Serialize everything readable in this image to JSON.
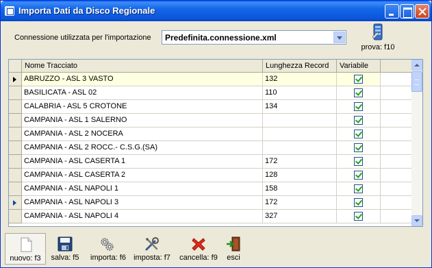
{
  "window": {
    "title": "Importa Dati da Disco Regionale"
  },
  "connection": {
    "label": "Connessione utilizzata  per  l'importazione",
    "value": "Predefinita.connessione.xml"
  },
  "prova": {
    "label": "prova: f10"
  },
  "grid": {
    "columns": [
      "Nome Tracciato",
      "Lunghezza Record",
      "Variabile"
    ],
    "rows": [
      {
        "name": "ABRUZZO - ASL 3  VASTO",
        "length": "132",
        "variable": true
      },
      {
        "name": "BASILICATA - ASL 02",
        "length": "110",
        "variable": true
      },
      {
        "name": "CALABRIA - ASL 5 CROTONE",
        "length": "134",
        "variable": true
      },
      {
        "name": "CAMPANIA - ASL 1 SALERNO",
        "length": "",
        "variable": true
      },
      {
        "name": "CAMPANIA - ASL 2 NOCERA",
        "length": "",
        "variable": true
      },
      {
        "name": "CAMPANIA - ASL  2 ROCC.- C.S.G.(SA)",
        "length": "",
        "variable": true
      },
      {
        "name": "CAMPANIA - ASL CASERTA 1",
        "length": "172",
        "variable": true
      },
      {
        "name": "CAMPANIA - ASL CASERTA 2",
        "length": "128",
        "variable": true
      },
      {
        "name": "CAMPANIA - ASL NAPOLI 1",
        "length": "158",
        "variable": true
      },
      {
        "name": "CAMPANIA - ASL NAPOLI 3",
        "length": "172",
        "variable": true
      },
      {
        "name": "CAMPANIA - ASL NAPOLI 4",
        "length": "327",
        "variable": true
      }
    ]
  },
  "toolbar": {
    "nuovo": "nuovo: f3",
    "salva": "salva: f5",
    "importa": "importa: f6",
    "imposta": "imposta: f7",
    "cancella": "cancella: f9",
    "esci": "esci"
  },
  "colors": {
    "titlebar": "#0b55d8",
    "window_bg": "#ece9d8",
    "selected_row": "#ffffe1",
    "checkmark": "#21a121"
  }
}
